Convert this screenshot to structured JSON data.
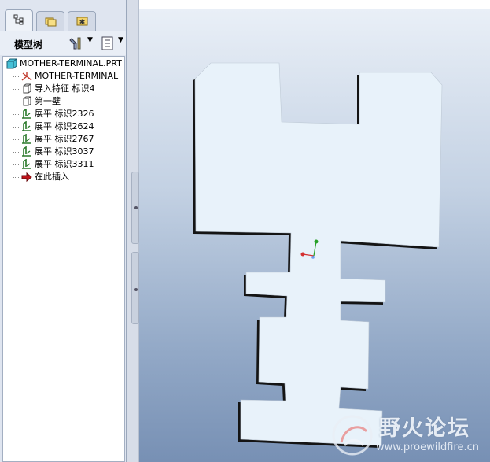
{
  "navigator": {
    "tabs": [
      {
        "name": "model-tree-tab",
        "icon": "model-tree-icon"
      },
      {
        "name": "folder-browser-tab",
        "icon": "folders-icon"
      },
      {
        "name": "favorites-tab",
        "icon": "favorites-icon"
      }
    ],
    "title": "模型树",
    "settings_icon": "tools-icon",
    "show_icon": "list-icon"
  },
  "tree": {
    "root": "MOTHER-TERMINAL.PRT",
    "items": [
      {
        "label": "MOTHER-TERMINAL",
        "icon": "csys-icon"
      },
      {
        "label": "导入特征 标识4",
        "icon": "feature-icon"
      },
      {
        "label": "第一壁",
        "icon": "wall-icon"
      },
      {
        "label": "展平 标识2326",
        "icon": "unbend-icon"
      },
      {
        "label": "展平 标识2624",
        "icon": "unbend-icon"
      },
      {
        "label": "展平 标识2767",
        "icon": "unbend-icon"
      },
      {
        "label": "展平 标识3037",
        "icon": "unbend-icon"
      },
      {
        "label": "展平 标识3311",
        "icon": "unbend-icon"
      },
      {
        "label": "在此插入",
        "icon": "insert-arrow-icon"
      }
    ]
  },
  "watermark": {
    "title": "野火论坛",
    "url": "www.proewildfire.cn"
  },
  "colors": {
    "part_fill": "#e8f2fa",
    "part_edge": "#1e1e1e",
    "viewport_top": "#e9eff7",
    "viewport_bottom": "#7790b4"
  }
}
